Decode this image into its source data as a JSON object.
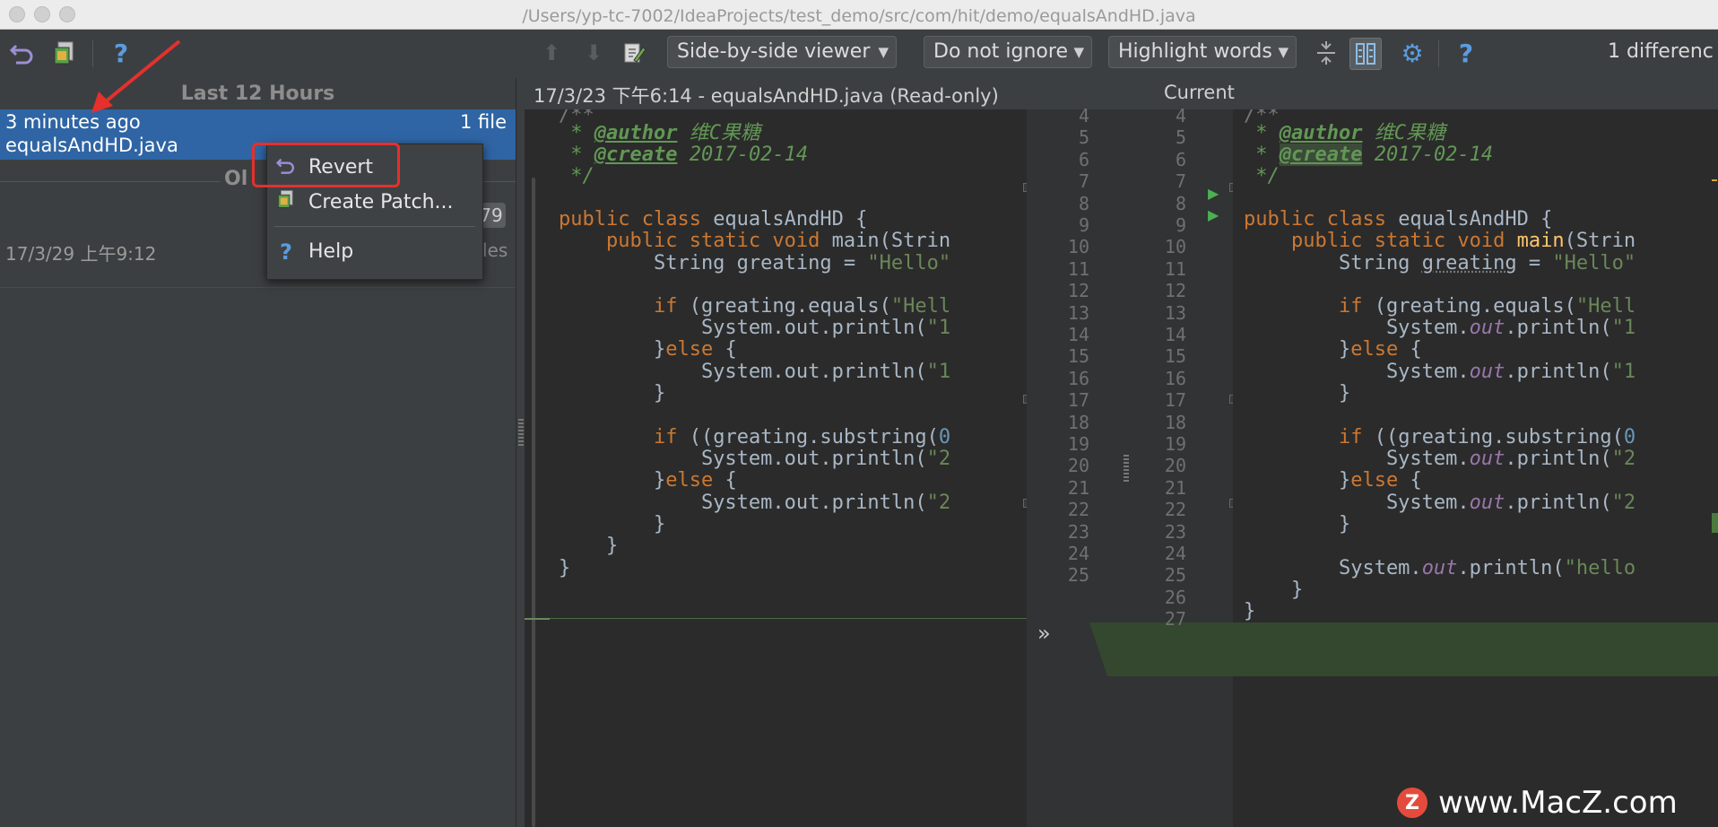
{
  "window": {
    "title": "/Users/yp-tc-7002/IdeaProjects/test_demo/src/com/hit/demo/equalsAndHD.java"
  },
  "toolbar": {
    "revert_icon": "undo-arrow",
    "patch_icon": "create-patch",
    "help_label": "?",
    "viewer_select": "Side-by-side viewer",
    "whitespace_select": "Do not ignore",
    "highlight_select": "Highlight words",
    "help_label_2": "?",
    "diff_count": "1 differenc"
  },
  "history_panel": {
    "header": "Last 12 Hours",
    "entries": [
      {
        "time": "3 minutes ago",
        "file": "equalsAndHD.java",
        "count": "1 file"
      }
    ],
    "older_label": "Ol",
    "older_badge": "79",
    "older_entry": {
      "date": "17/3/29 上午9:12",
      "files": "les"
    }
  },
  "context_menu": {
    "items": [
      {
        "label": "Revert",
        "icon": "undo-icon"
      },
      {
        "label": "Create Patch...",
        "icon": "patch-icon"
      },
      {
        "label": "Help",
        "icon": "help-icon",
        "glyph": "?"
      }
    ]
  },
  "editor": {
    "left_header": "17/3/23 下午6:14 - equalsAndHD.java (Read-only)",
    "right_header": "Current",
    "diff_marker": "»",
    "left_line_numbers": [
      "4",
      "5",
      "6",
      "7",
      "8",
      "9",
      "10",
      "11",
      "12",
      "13",
      "14",
      "15",
      "16",
      "17",
      "18",
      "19",
      "20",
      "21",
      "22",
      "23",
      "24",
      "25"
    ],
    "right_line_numbers": [
      "4",
      "5",
      "6",
      "7",
      "8",
      "9",
      "10",
      "11",
      "12",
      "13",
      "14",
      "15",
      "16",
      "17",
      "18",
      "19",
      "20",
      "21",
      "22",
      "23",
      "24",
      "25",
      "26",
      "27"
    ],
    "left_code": [
      " * @author 维C果糖",
      " * @create 2017-02-14",
      " */",
      "",
      "public class equalsAndHD {",
      "    public static void main(Strin",
      "        String greating = \"Hello\"",
      "",
      "        if (greating.equals(\"Hell",
      "            System.out.println(\"1",
      "        }else {",
      "            System.out.println(\"1",
      "        }",
      "",
      "        if ((greating.substring(0",
      "            System.out.println(\"2",
      "        }else {",
      "            System.out.println(\"2",
      "        }",
      "    }",
      "}"
    ],
    "right_code": [
      " * @author 维C果糖",
      " * @create 2017-02-14",
      " */",
      "",
      "public class equalsAndHD {",
      "    public static void main(Strin",
      "        String greating = \"Hello\"",
      "",
      "        if (greating.equals(\"Hell",
      "            System.out.println(\"1",
      "        }else {",
      "            System.out.println(\"1",
      "        }",
      "",
      "        if ((greating.substring(0",
      "            System.out.println(\"2",
      "        }else {",
      "            System.out.println(\"2",
      "        }",
      "",
      "        System.out.println(\"hello",
      "    }",
      "}"
    ]
  },
  "watermark": {
    "logo": "Z",
    "text": "www.MacZ.com"
  },
  "colors": {
    "selection": "#2f65a4",
    "annotation_red": "#e5302c",
    "diff_added": "#34472f"
  }
}
